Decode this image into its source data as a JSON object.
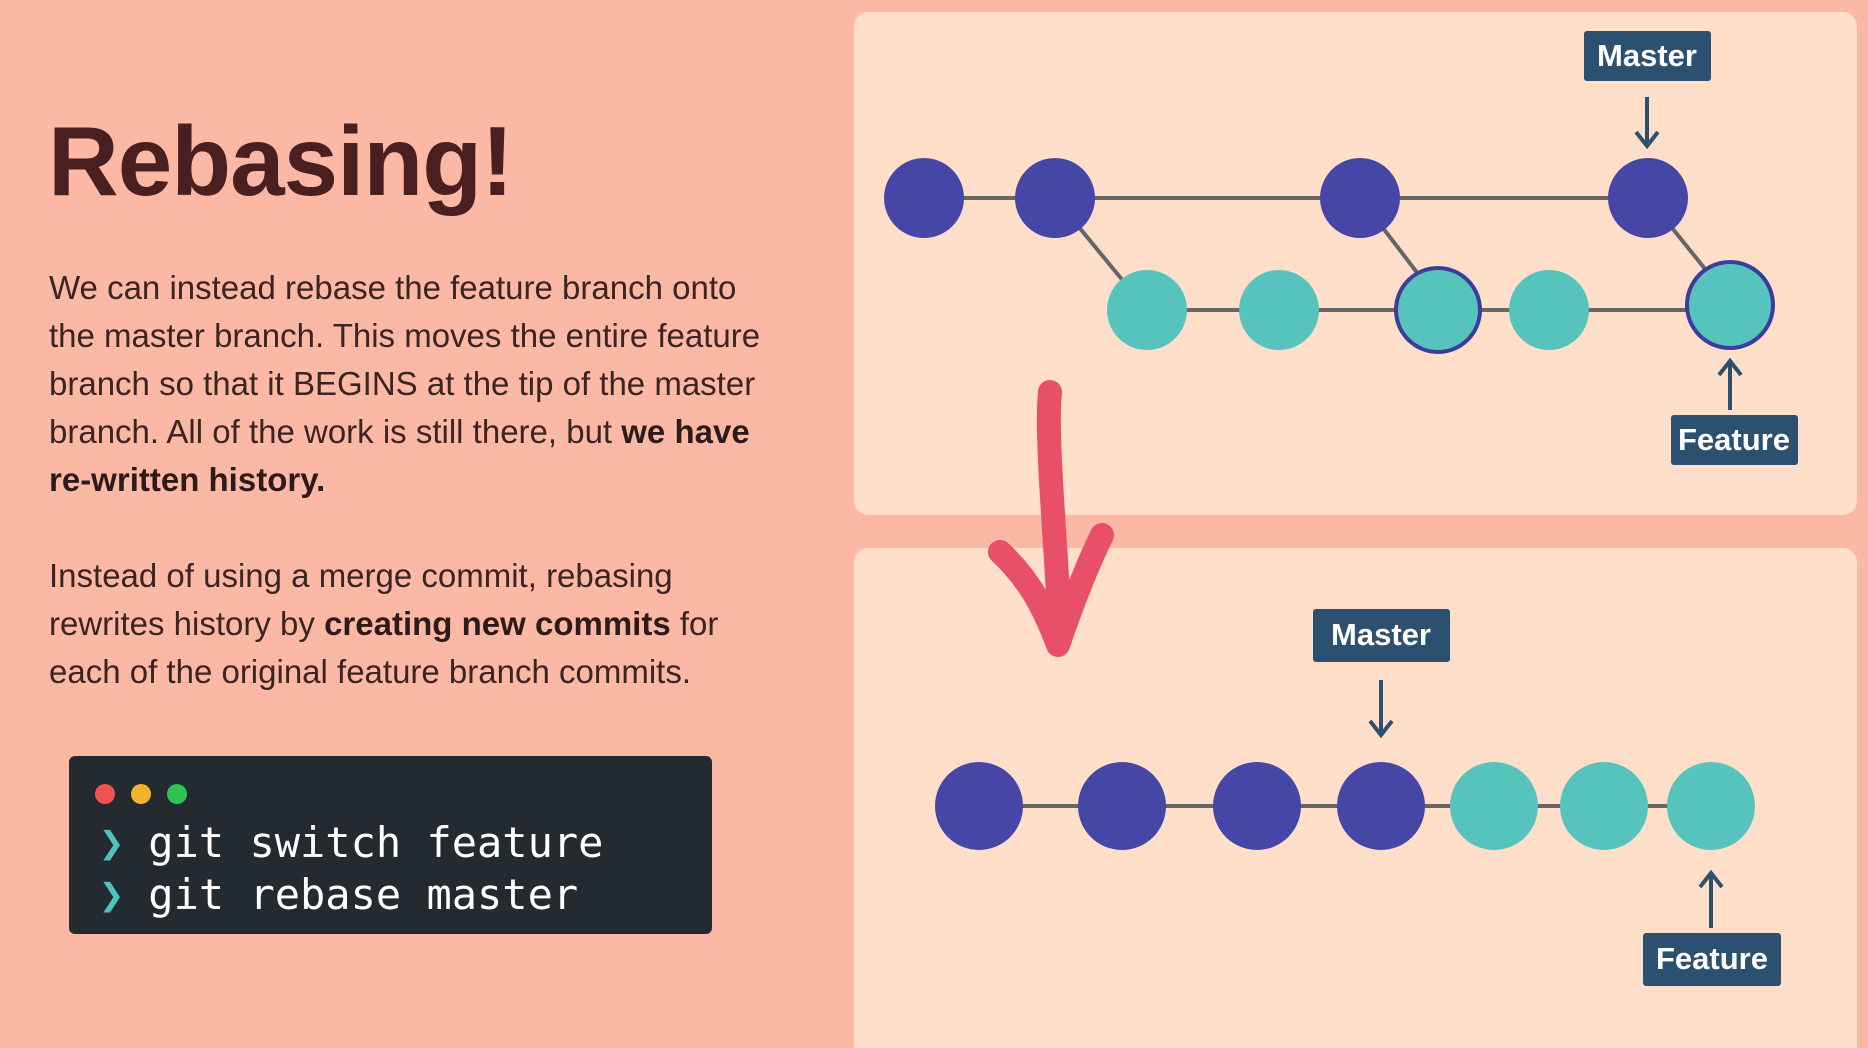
{
  "slide": {
    "title": "Rebasing!",
    "paragraph1": {
      "normal": "We can instead rebase the feature branch onto the master branch.  This moves the entire feature branch so that it BEGINS at the tip of the master branch.  All of the work is still there, but ",
      "bold": "we have re-written history."
    },
    "paragraph2": {
      "before": "Instead of using a merge commit, rebasing rewrites history by ",
      "bold": "creating new commits",
      "after": " for each of the original feature branch commits."
    }
  },
  "terminal": {
    "prompt_symbol": "❯",
    "commands": [
      "git switch feature",
      "git rebase master"
    ]
  },
  "diagram": {
    "colors": {
      "master_commit": "#4646a6",
      "feature_commit": "#56c3bc",
      "line": "#666666",
      "label_bg": "#2b5070",
      "arrow": "#e8506a"
    },
    "before": {
      "master_label": "Master",
      "feature_label": "Feature",
      "master_commits": 4,
      "feature_commits": 5
    },
    "after": {
      "master_label": "Master",
      "feature_label": "Feature",
      "master_commits": 4,
      "feature_commits": 3
    }
  }
}
